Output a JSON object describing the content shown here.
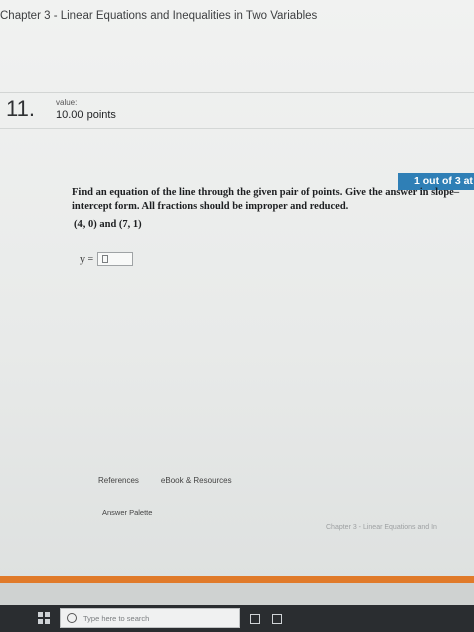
{
  "chapter": {
    "title": "Chapter 3 - Linear Equations and Inequalities in Two Variables"
  },
  "question": {
    "number": "11.",
    "value_label": "value:",
    "points": "10.00 points",
    "attempt_badge": "1 out of 3 at",
    "prompt": "Find an equation of the line through the given pair of points. Give the answer in slope–intercept form. All fractions should be improper and reduced.",
    "points_pair": "(4, 0) and (7, 1)",
    "answer_label": "y =",
    "answer_value": ""
  },
  "nav": {
    "references": "References",
    "ebook": "eBook & Resources",
    "answer_palette": "Answer Palette",
    "footer_chapter": "Chapter 3 - Linear Equations and In"
  },
  "taskbar": {
    "search_placeholder": "Type here to search"
  },
  "colors": {
    "badge": "#2f7fb6",
    "accent_bar": "#e07a2a",
    "taskbar": "#2a2d30"
  }
}
